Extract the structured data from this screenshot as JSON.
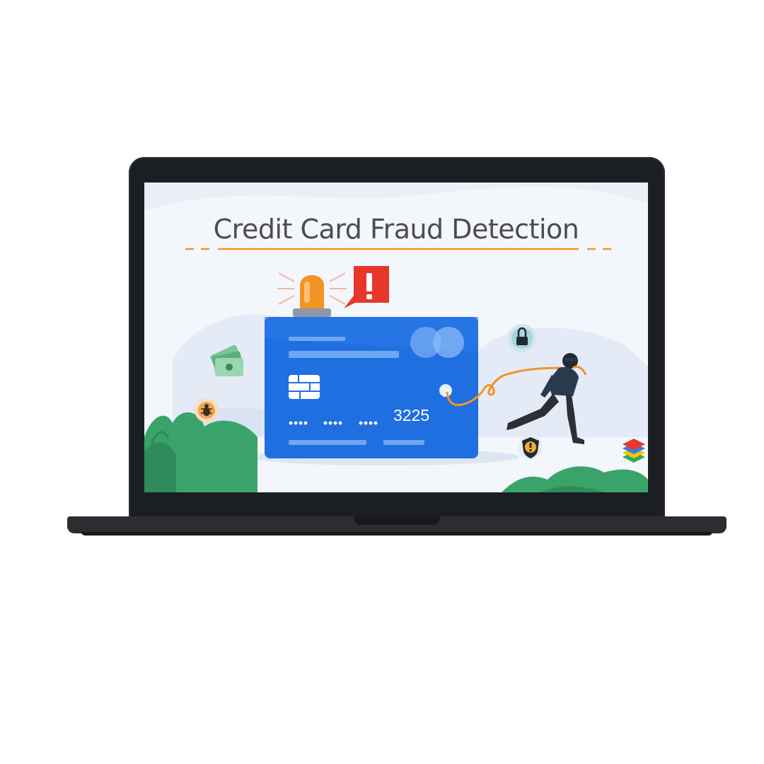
{
  "slide": {
    "title": "Credit Card Fraud Detection",
    "card_last_digits": "3225"
  },
  "icons": [
    "alarm-light-icon",
    "alert-exclamation-icon",
    "lock-icon",
    "money-icon",
    "bug-icon",
    "shield-alert-icon",
    "layers-icon",
    "thief-icon"
  ],
  "colors": {
    "card_blue": "#1f6fe0",
    "accent_orange": "#f39323",
    "alert_red": "#e8362a",
    "leaf_green": "#3aa36a"
  }
}
